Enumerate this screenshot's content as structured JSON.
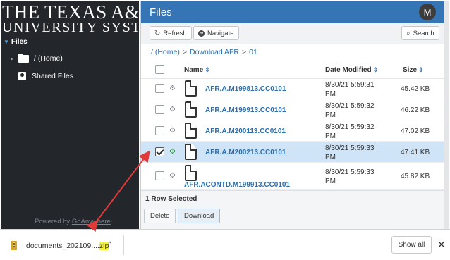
{
  "sidebar": {
    "logo_line1": "THE TEXAS A&M",
    "logo_line2": "UNIVERSITY SYSTEM",
    "section_label": "Files",
    "items": [
      {
        "label": "/ (Home)"
      },
      {
        "label": "Shared Files"
      }
    ],
    "powered_prefix": "Powered by ",
    "powered_link": "GoAnywhere"
  },
  "header": {
    "title": "Files",
    "avatar_initial": "M"
  },
  "toolbar": {
    "refresh_label": "Refresh",
    "navigate_label": "Navigate",
    "search_label": "Search"
  },
  "breadcrumb": {
    "items": [
      "/ (Home)",
      "Download AFR",
      "01"
    ],
    "separator": ">"
  },
  "table": {
    "columns": {
      "name": "Name",
      "date": "Date Modified",
      "size": "Size"
    },
    "rows": [
      {
        "name": "AFR.A.M199813.CC0101",
        "date": "8/30/21 5:59:31 PM",
        "size": "45.42 KB",
        "selected": false
      },
      {
        "name": "AFR.A.M199913.CC0101",
        "date": "8/30/21 5:59:32 PM",
        "size": "46.22 KB",
        "selected": false
      },
      {
        "name": "AFR.A.M200113.CC0101",
        "date": "8/30/21 5:59:32 PM",
        "size": "47.02 KB",
        "selected": false
      },
      {
        "name": "AFR.A.M200213.CC0101",
        "date": "8/30/21 5:59:33 PM",
        "size": "47.41 KB",
        "selected": true
      },
      {
        "name": "AFR.ACONTD.M199913.CC0101",
        "date": "8/30/21 5:59:33 PM",
        "size": "45.82 KB",
        "selected": false
      }
    ]
  },
  "footer": {
    "selection_status": "1 Row Selected",
    "delete_label": "Delete",
    "download_label": "Download"
  },
  "download_bar": {
    "file_name_prefix": "documents_202109....",
    "file_name_ext": "zip",
    "show_all_label": "Show all"
  },
  "colors": {
    "header_blue": "#3574b5",
    "sidebar_dark": "#23262b",
    "selected_row": "#cfe4f6",
    "link_blue": "#2a6fb0",
    "annotation_red": "#e03a3a",
    "highlight_yellow": "#f6f23a"
  },
  "icons": {
    "refresh": "refresh-icon",
    "navigate": "navigate-icon",
    "search": "search-icon",
    "gear": "gear-icon",
    "file": "file-icon",
    "folder": "folder-icon",
    "shared": "shared-folder-icon",
    "zip": "zip-file-icon"
  }
}
